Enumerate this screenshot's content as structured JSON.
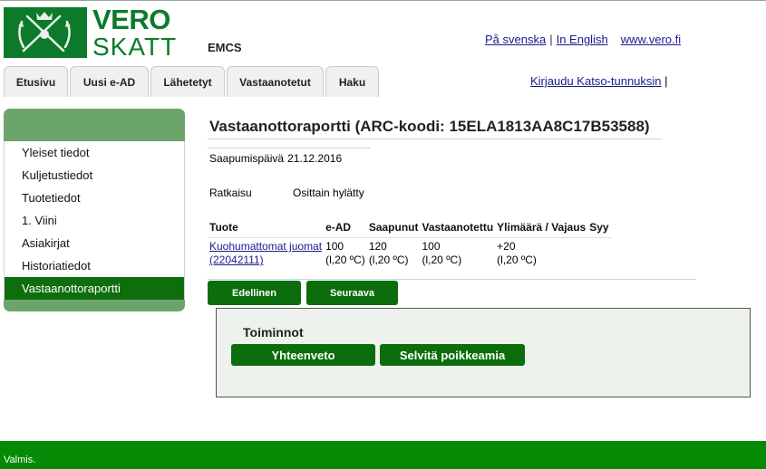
{
  "header": {
    "logo_top": "VERO",
    "logo_bottom": "SKATT",
    "app_name": "EMCS",
    "links": [
      "På svenska",
      "In English",
      "www.vero.fi"
    ],
    "login_link": "Kirjaudu Katso-tunnuksin"
  },
  "tabs": [
    "Etusivu",
    "Uusi e-AD",
    "Lähetetyt",
    "Vastaanotetut",
    "Haku"
  ],
  "sidebar": {
    "items": [
      {
        "label": "Yleiset tiedot",
        "active": false
      },
      {
        "label": "Kuljetustiedot",
        "active": false
      },
      {
        "label": "Tuotetiedot",
        "active": false
      },
      {
        "label": "1. Viini",
        "active": false
      },
      {
        "label": "Asiakirjat",
        "active": false
      },
      {
        "label": "Historiatiedot",
        "active": false
      },
      {
        "label": "Vastaanottoraportti",
        "active": true
      }
    ]
  },
  "main": {
    "title": "Vastaanottoraportti (ARC-koodi: 15ELA1813AA8C17B53588)",
    "arrival_label": "Saapumispäivä",
    "arrival_date": "21.12.2016",
    "resolution_label": "Ratkaisu",
    "resolution_value": "Osittain hylätty",
    "table": {
      "headers": [
        "Tuote",
        "e-AD",
        "Saapunut",
        "Vastaanotettu",
        "Ylimäärä / Vajaus",
        "Syy"
      ],
      "rows": [
        {
          "product_name": "Kuohumattomat juomat",
          "product_code": "(22042111)",
          "cells": [
            {
              "value": "100",
              "unit": "(l,20 ºC)"
            },
            {
              "value": "120",
              "unit": "(l,20 ºC)"
            },
            {
              "value": "100",
              "unit": "(l,20 ºC)"
            },
            {
              "value": "+20",
              "unit": "(l,20 ºC)"
            },
            {
              "value": "",
              "unit": ""
            }
          ]
        }
      ]
    },
    "nav_buttons": {
      "previous": "Edellinen",
      "next": "Seuraava"
    },
    "actions": {
      "title": "Toiminnot",
      "summary_button": "Yhteenveto",
      "resolve_button": "Selvitä poikkeamia"
    }
  },
  "status_bar": {
    "text": "Valmis."
  },
  "colors": {
    "brand_green": "#0d7a2b",
    "button_green": "#0b6d0b",
    "sidebar_green": "#6ba56b",
    "statusbar_green": "#058a05",
    "link_blue": "#1a1a8c"
  }
}
